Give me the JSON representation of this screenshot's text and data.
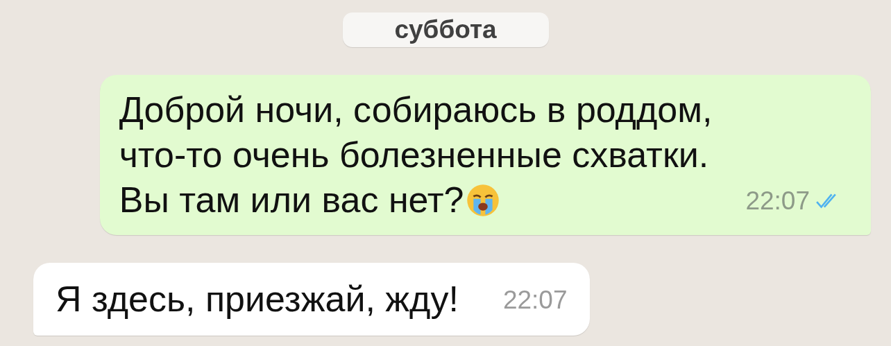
{
  "date_chip": "суббота",
  "messages": [
    {
      "kind": "outgoing",
      "lines": [
        "Доброй ночи, собираюсь в роддом,",
        "что-то очень болезненные схватки.",
        "Вы там или вас нет?"
      ],
      "crying_emoji": true,
      "time": "22:07",
      "read": true
    },
    {
      "kind": "incoming",
      "lines": [
        "Я здесь, приезжай, жду!"
      ],
      "time": "22:07"
    }
  ]
}
